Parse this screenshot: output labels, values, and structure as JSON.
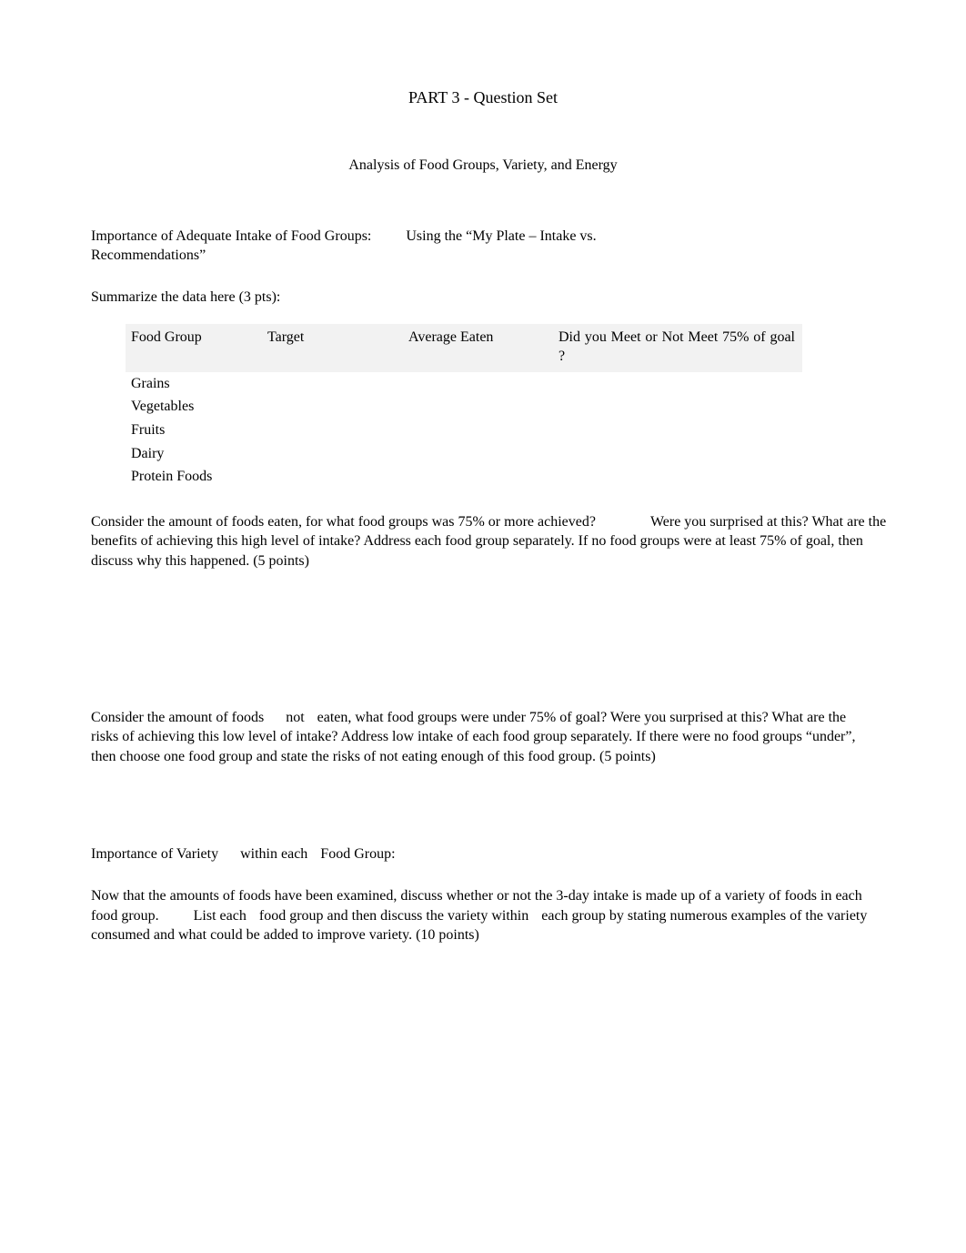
{
  "title": "PART 3 - Question Set",
  "subtitle": "Analysis of Food Groups, Variety, and Energy",
  "intro": {
    "line1a": "Importance of Adequate Intake of Food Groups:",
    "line1b": "Using the “My Plate – Intake vs.",
    "line2": "Recommendations”"
  },
  "summarize": "Summarize the data here (3 pts):",
  "table": {
    "headers": {
      "c1": "Food Group",
      "c2": "Target",
      "c3": "Average Eaten",
      "c4": "Did you Meet or Not Meet 75% of goal ?"
    },
    "rows": [
      {
        "label": "Grains",
        "target": "",
        "avg": "",
        "meet": ""
      },
      {
        "label": "Vegetables",
        "target": "",
        "avg": "",
        "meet": ""
      },
      {
        "label": "Fruits",
        "target": "",
        "avg": "",
        "meet": ""
      },
      {
        "label": "Dairy",
        "target": "",
        "avg": "",
        "meet": ""
      },
      {
        "label": "Protein Foods",
        "target": "",
        "avg": "",
        "meet": ""
      }
    ]
  },
  "q1": {
    "part1": "Consider the amount of foods eaten, for what food groups was 75% or more achieved?",
    "part2": "Were you",
    "rest": "surprised at this? What are the benefits of achieving this high level of intake? Address each food group separately. If no food groups were at least 75% of goal, then discuss why this happened. (5 points)"
  },
  "q2": {
    "lead": "Consider the amount of foods",
    "not": "not",
    "tail": "eaten, what food groups were under 75% of goal? Were you",
    "rest": "surprised at this? What are the risks of achieving this low level of intake? Address low intake of each food group separately. If there were no food groups “under”, then choose one food group and state the risks of not eating enough of this food group. (5 points)"
  },
  "variety": {
    "heading_a": "Importance of Variety",
    "heading_b": "within each",
    "heading_c": "Food Group:",
    "para_a": "Now that the amounts of foods have been examined, discuss whether or not the 3-day intake is made up of a variety of foods in each food group.",
    "para_b": "List each",
    "para_c": "food group and then discuss the variety",
    "para_d": "within",
    "para_e": "each group by stating numerous examples of the variety consumed and what could be added to improve variety. (10 points)"
  }
}
